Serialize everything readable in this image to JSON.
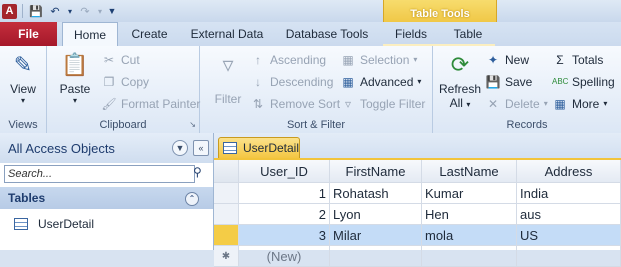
{
  "window": {
    "title": "",
    "ctx_group": "Table Tools"
  },
  "tabs": [
    "File",
    "Home",
    "Create",
    "External Data",
    "Database Tools",
    "Fields",
    "Table"
  ],
  "groups": {
    "views": {
      "label": "Views",
      "view": "View"
    },
    "clipboard": {
      "label": "Clipboard",
      "paste": "Paste",
      "cut": "Cut",
      "copy": "Copy",
      "format_painter": "Format Painter"
    },
    "sort_filter": {
      "label": "Sort & Filter",
      "filter": "Filter",
      "ascending": "Ascending",
      "descending": "Descending",
      "remove_sort": "Remove Sort",
      "selection": "Selection",
      "advanced": "Advanced",
      "toggle_filter": "Toggle Filter"
    },
    "records": {
      "label": "Records",
      "refresh": "Refresh",
      "refresh_all": "All",
      "new": "New",
      "save": "Save",
      "delete": "Delete",
      "totals": "Totals",
      "spelling": "Spelling",
      "more": "More"
    }
  },
  "nav": {
    "header": "All Access Objects",
    "search_placeholder": "Search...",
    "group": "Tables",
    "items": [
      "UserDetail"
    ]
  },
  "document": {
    "tab": "UserDetail",
    "columns": [
      "User_ID",
      "FirstName",
      "LastName",
      "Address"
    ],
    "rows": [
      [
        "1",
        "Rohatash",
        "Kumar",
        "India"
      ],
      [
        "2",
        "Lyon",
        "Hen",
        "aus"
      ],
      [
        "3",
        "Milar",
        "mola",
        "US"
      ]
    ],
    "new_row_label": "(New)",
    "current_row_index": 2
  },
  "colors": {
    "file_tab": "#a5182a",
    "ctx_header": "#eec13b",
    "current_row": "#c4dcf7"
  }
}
